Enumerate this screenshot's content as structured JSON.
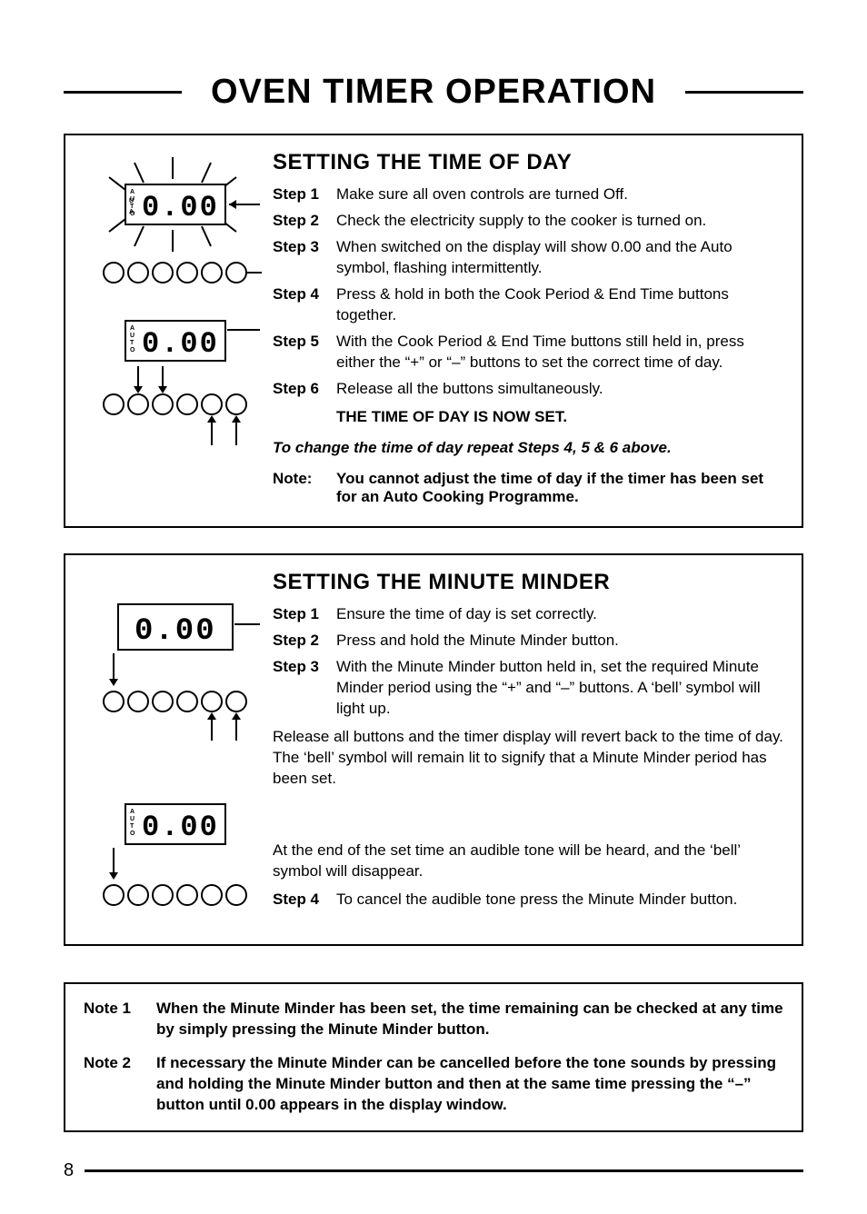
{
  "title": "OVEN TIMER OPERATION",
  "section1": {
    "heading": "SETTING THE TIME OF DAY",
    "steps": [
      {
        "label": "Step 1",
        "body": "Make sure all oven controls are turned Off."
      },
      {
        "label": "Step 2",
        "body": "Check the electricity supply to the cooker is turned on."
      },
      {
        "label": "Step 3",
        "body": "When switched on the display will show 0.00 and the Auto symbol, flashing intermittently."
      },
      {
        "label": "Step 4",
        "body": "Press & hold in both the Cook Period & End Time buttons together."
      },
      {
        "label": "Step 5",
        "body": "With the Cook Period & End Time buttons still held in, press either the “+” or “–” buttons to set the correct time of day."
      },
      {
        "label": "Step 6",
        "body": "Release all the buttons simultaneously."
      }
    ],
    "set_line": "THE TIME OF DAY IS NOW SET.",
    "change_line": "To change the time of day repeat Steps 4, 5 & 6 above.",
    "note_label": "Note:",
    "note_body": "You cannot adjust the time of day if the timer has been set for an Auto Cooking Programme."
  },
  "section2": {
    "heading": "SETTING THE MINUTE MINDER",
    "steps_a": [
      {
        "label": "Step 1",
        "body": "Ensure the time of day is set correctly."
      },
      {
        "label": "Step 2",
        "body": "Press and hold the  Minute Minder button."
      },
      {
        "label": "Step 3",
        "body": "With the Minute Minder button held in, set the required Minute Minder period using the “+” and “–” buttons. A ‘bell’ symbol will light up."
      }
    ],
    "para1": "Release all buttons and the timer display will revert back to the time of day. The ‘bell’ symbol will remain lit to signify that a Minute Minder period has been set.",
    "para2": "At the end of the set time an audible tone will be heard, and the ‘bell’ symbol will disappear.",
    "step4": {
      "label": "Step 4",
      "body": "To cancel the audible tone press the Minute Minder button."
    }
  },
  "notes": [
    {
      "label": "Note 1",
      "body": "When the Minute Minder has been set, the time remaining can be checked at any time by simply pressing the Minute Minder button."
    },
    {
      "label": "Note 2",
      "body": "If necessary the Minute Minder can be cancelled before the tone sounds by pressing and holding the Minute Minder button and then at the same time pressing the “–” button until 0.00 appears in the display window."
    }
  ],
  "display_value": "0.00",
  "auto_label": "AUTO",
  "page_number": "8"
}
